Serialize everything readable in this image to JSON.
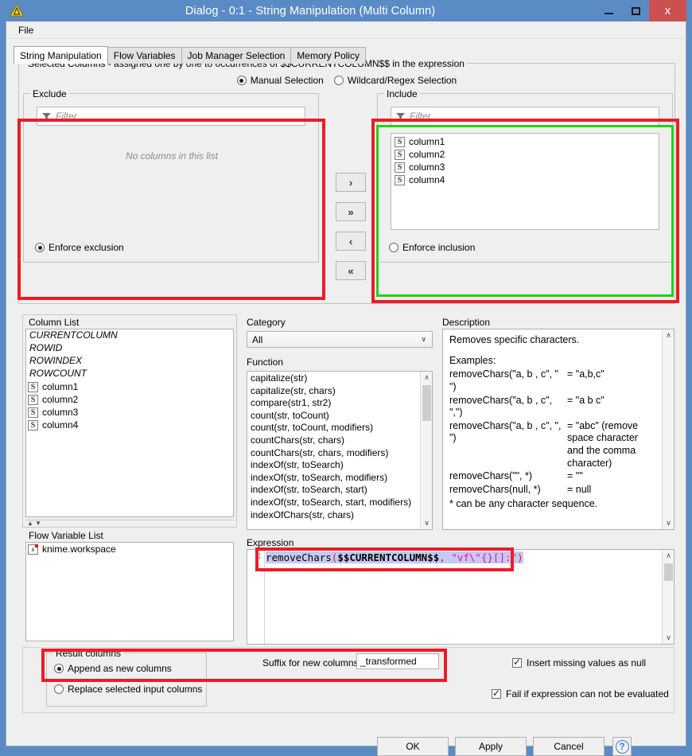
{
  "window": {
    "title": "Dialog - 0:1 - String Manipulation (Multi Column)",
    "icon": "knime-warning-icon",
    "minimize_label": "Minimize",
    "maximize_label": "Maximize",
    "close_label": "x",
    "titlebar_color": "#5b8bc4",
    "close_button_color": "#cb5050"
  },
  "menubar": {
    "items": [
      "File"
    ]
  },
  "tabs": [
    {
      "label": "String Manipulation",
      "active": true
    },
    {
      "label": "Flow Variables",
      "active": false
    },
    {
      "label": "Job Manager Selection",
      "active": false
    },
    {
      "label": "Memory Policy",
      "active": false
    }
  ],
  "selected_columns": {
    "legend": "Selected Columns - assigned one by one to occurrences of $$CURRENTCOLUMN$$ in the expression",
    "mode_options": [
      {
        "label": "Manual Selection",
        "selected": true
      },
      {
        "label": "Wildcard/Regex Selection",
        "selected": false
      }
    ],
    "exclude": {
      "legend": "Exclude",
      "filter_placeholder": "Filter",
      "empty_message": "No columns in this list",
      "items": [],
      "enforce_label": "Enforce exclusion",
      "enforce_selected": true
    },
    "include": {
      "legend": "Include",
      "filter_placeholder": "Filter",
      "items": [
        "column1",
        "column2",
        "column3",
        "column4"
      ],
      "item_type_badge": "S",
      "enforce_label": "Enforce inclusion",
      "enforce_selected": false
    },
    "transfer_buttons": [
      {
        "name": "move-right",
        "glyph": "›"
      },
      {
        "name": "move-all-right",
        "glyph": "»"
      },
      {
        "name": "move-left",
        "glyph": "‹"
      },
      {
        "name": "move-all-left",
        "glyph": "«"
      }
    ]
  },
  "column_list": {
    "label": "Column List",
    "special_items": [
      "CURRENTCOLUMN",
      "ROWID",
      "ROWINDEX",
      "ROWCOUNT"
    ],
    "columns": [
      "column1",
      "column2",
      "column3",
      "column4"
    ],
    "badge": "S"
  },
  "flow_variable_list": {
    "label": "Flow Variable List",
    "items": [
      "knime.workspace"
    ],
    "badge": "s"
  },
  "category": {
    "label": "Category",
    "selected": "All",
    "options": [
      "All"
    ]
  },
  "function": {
    "label": "Function",
    "items": [
      "capitalize(str)",
      "capitalize(str, chars)",
      "compare(str1, str2)",
      "count(str, toCount)",
      "count(str, toCount, modifiers)",
      "countChars(str, chars)",
      "countChars(str, chars, modifiers)",
      "indexOf(str, toSearch)",
      "indexOf(str, toSearch, modifiers)",
      "indexOf(str, toSearch, start)",
      "indexOf(str, toSearch, start, modifiers)",
      "indexOfChars(str, chars)"
    ]
  },
  "description": {
    "label": "Description",
    "headline": "Removes specific characters.",
    "examples_label": "Examples:",
    "examples": [
      {
        "call": "removeChars(\"a,  b , c\", \" \")",
        "result": "= \"a,b,c\""
      },
      {
        "call": "removeChars(\"a,  b , c\", \",\")",
        "result": "= \"a  b  c\""
      },
      {
        "call": "removeChars(\"a,  b , c\", \", \")",
        "result": "= \"abc\" (remove space character and the comma character)"
      },
      {
        "call": "removeChars(\"\", *)",
        "result": "= \"\""
      },
      {
        "call": "removeChars(null, *)",
        "result": "= null"
      }
    ],
    "footnote": "* can be any character sequence."
  },
  "expression": {
    "label": "Expression",
    "line_number": "1",
    "text": "removeChars($$CURRENTCOLUMN$$, \"vf\\\"{}[]:\")",
    "tokens": {
      "fn": "removeChars",
      "open_paren": "(",
      "variable": "$$CURRENTCOLUMN$$",
      "comma": ", ",
      "string": "\"vf\\\"{}[]:\"",
      "close_paren": ")"
    },
    "highlight_color": "#c8c8f4"
  },
  "result_columns": {
    "legend": "Result columns",
    "options": [
      {
        "label": "Append as new columns",
        "selected": true
      },
      {
        "label": "Replace selected input columns",
        "selected": false
      }
    ]
  },
  "suffix": {
    "label": "Suffix for new columns",
    "value": "_transformed"
  },
  "checkboxes": [
    {
      "label": "Insert missing values as null",
      "checked": true
    },
    {
      "label": "Fail if expression can not be evaluated",
      "checked": true
    }
  ],
  "dialog_buttons": [
    {
      "label": "OK"
    },
    {
      "label": "Apply"
    },
    {
      "label": "Cancel"
    }
  ],
  "help_button": {
    "glyph": "?"
  },
  "annotations": {
    "highlight_color_red": "#ee1c25",
    "highlight_color_green": "#1fd411"
  }
}
